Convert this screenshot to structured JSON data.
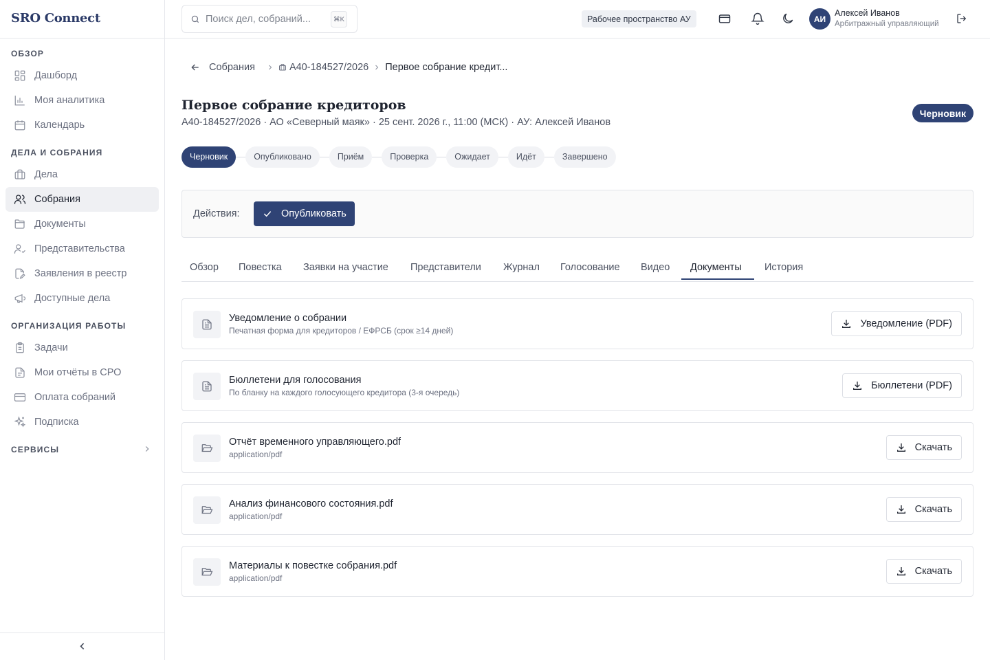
{
  "app": {
    "brand": "SRO Connect"
  },
  "sidebar": {
    "sections": [
      {
        "title": "ОБЗОР"
      },
      {
        "title": "ДЕЛА И СОБРАНИЯ"
      },
      {
        "title": "ОРГАНИЗАЦИЯ РАБОТЫ"
      },
      {
        "title": "СЕРВИСЫ"
      }
    ],
    "items": [
      {
        "label": "Дашборд",
        "icon": "dashboard-icon"
      },
      {
        "label": "Моя аналитика",
        "icon": "analytics-icon"
      },
      {
        "label": "Календарь",
        "icon": "calendar-icon"
      },
      {
        "label": "Дела",
        "icon": "briefcase-icon"
      },
      {
        "label": "Собрания",
        "icon": "users-icon",
        "active": true
      },
      {
        "label": "Документы",
        "icon": "folder-icon"
      },
      {
        "label": "Представительства",
        "icon": "user-check-icon"
      },
      {
        "label": "Заявления в реестр",
        "icon": "file-edit-icon"
      },
      {
        "label": "Доступные дела",
        "icon": "megaphone-icon"
      },
      {
        "label": "Задачи",
        "icon": "clipboard-icon"
      },
      {
        "label": "Мои отчёты в СРО",
        "icon": "report-icon"
      },
      {
        "label": "Оплата собраний",
        "icon": "credit-card-icon"
      },
      {
        "label": "Подписка",
        "icon": "sparkles-icon"
      }
    ]
  },
  "header": {
    "search_placeholder": "Поиск дел, собраний...",
    "search_shortcut": "⌘K",
    "workspace": "Рабочее пространство АУ",
    "user": {
      "initials": "АИ",
      "name": "Алексей Иванов",
      "role": "Арбитражный управляющий"
    }
  },
  "breadcrumb": {
    "parent": "Собрания",
    "case": "А40-184527/2026",
    "current": "Первое собрание кредит..."
  },
  "meeting": {
    "title": "Первое собрание кредиторов",
    "subtitle": "А40-184527/2026 · АО «Северный маяк» · 25 сент. 2026 г., 11:00 (МСК) · АУ: Алексей Иванов",
    "status": "Черновик"
  },
  "stepper": {
    "steps": [
      "Черновик",
      "Опубликовано",
      "Приём",
      "Проверка",
      "Ожидает",
      "Идёт",
      "Завершено"
    ],
    "active_index": 0
  },
  "actions": {
    "label": "Действия:",
    "publish": "Опубликовать"
  },
  "tabs": {
    "items": [
      "Обзор",
      "Повестка",
      "Заявки на участие",
      "Представители",
      "Журнал",
      "Голосование",
      "Видео",
      "Документы",
      "История"
    ],
    "active": "Документы"
  },
  "documents": [
    {
      "title": "Уведомление о собрании",
      "subtitle": "Печатная форма для кредиторов / ЕФРСБ (срок ≥14 дней)",
      "button": "Уведомление (PDF)",
      "icon": "file-text-icon"
    },
    {
      "title": "Бюллетени для голосования",
      "subtitle": "По бланку на каждого голосующего кредитора (3-я очередь)",
      "button": "Бюллетени (PDF)",
      "icon": "file-text-icon"
    },
    {
      "title": "Отчёт временного управляющего.pdf",
      "subtitle": "application/pdf",
      "button": "Скачать",
      "icon": "folder-open-icon"
    },
    {
      "title": "Анализ финансового состояния.pdf",
      "subtitle": "application/pdf",
      "button": "Скачать",
      "icon": "folder-open-icon"
    },
    {
      "title": "Материалы к повестке собрания.pdf",
      "subtitle": "application/pdf",
      "button": "Скачать",
      "icon": "folder-open-icon"
    }
  ]
}
